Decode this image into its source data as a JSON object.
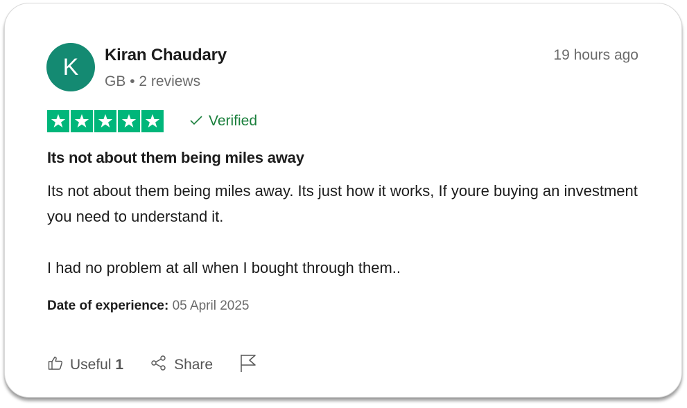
{
  "reviewer": {
    "initial": "K",
    "name": "Kiran Chaudary",
    "country": "GB",
    "separator": "•",
    "review_count": "2 reviews"
  },
  "time_ago": "19 hours ago",
  "rating": {
    "stars": 5,
    "max": 5,
    "star_color": "#00b67a"
  },
  "verified": {
    "label": "Verified",
    "icon": "check-icon"
  },
  "review": {
    "title": "Its not about them being miles away",
    "paragraph_1": "Its not about them being miles away. Its just how it works, If youre buying an investment you need to understand it.",
    "paragraph_2": "I had no problem at all when I bought through them.."
  },
  "date_of_experience": {
    "label": "Date of experience:",
    "value": "05 April 2025"
  },
  "actions": {
    "useful_label": "Useful",
    "useful_count": "1",
    "share_label": "Share"
  },
  "colors": {
    "avatar_bg": "#148a72",
    "verified_text": "#1a7f3c",
    "text_primary": "#1c1c1c",
    "text_secondary": "#6b6b6b"
  }
}
